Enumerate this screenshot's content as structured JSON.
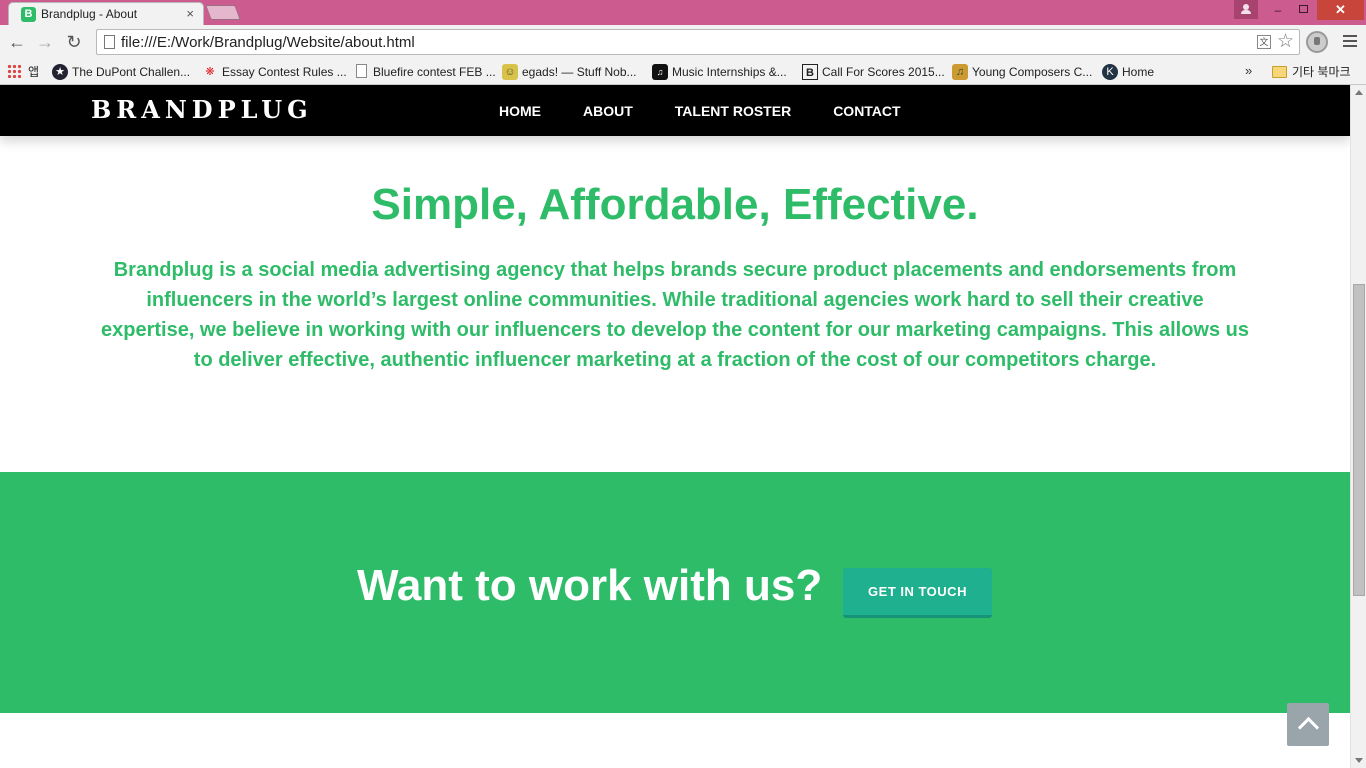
{
  "browser": {
    "tab_title": "Brandplug - About",
    "tab_favicon_letter": "B",
    "tab_close": "×",
    "url": "file:///E:/Work/Brandplug/Website/about.html",
    "window_minimize": "–",
    "window_close": "✕"
  },
  "bookmarks": {
    "apps_label": "앱",
    "items": [
      {
        "label": "The DuPont Challen...",
        "icon": "dupont-icon"
      },
      {
        "label": "Essay Contest Rules ...",
        "icon": "flower-icon"
      },
      {
        "label": "Bluefire contest FEB ...",
        "icon": "page-icon"
      },
      {
        "label": "egads! — Stuff Nob...",
        "icon": "egads-icon"
      },
      {
        "label": "Music Internships &...",
        "icon": "music-icon"
      },
      {
        "label": "Call For Scores 2015...",
        "icon": "b-logo-icon"
      },
      {
        "label": "Young Composers C...",
        "icon": "composer-icon"
      },
      {
        "label": "Home",
        "icon": "kiwanis-icon"
      }
    ],
    "more": "»",
    "other_folder": "기타 북마크"
  },
  "site": {
    "logo": "BRANDPLUG",
    "nav": [
      "HOME",
      "ABOUT",
      "TALENT ROSTER",
      "CONTACT"
    ],
    "about_heading": "Simple, Affordable, Effective.",
    "about_text": "Brandplug is a social media advertising agency that helps brands secure product placements and endorsements from influencers in the world’s largest online communities. While traditional agencies work hard to sell their creative expertise, we believe in working with our influencers to develop the content for our marketing campaigns. This allows us to deliver effective, authentic influencer marketing at a fraction of the cost of our competitors charge.",
    "cta_heading": "Want to work with us?",
    "cta_button": "GET IN TOUCH"
  },
  "colors": {
    "brand_green": "#2fbc69",
    "button_teal": "#1fb08f",
    "titlebar": "#cc5c8f"
  }
}
